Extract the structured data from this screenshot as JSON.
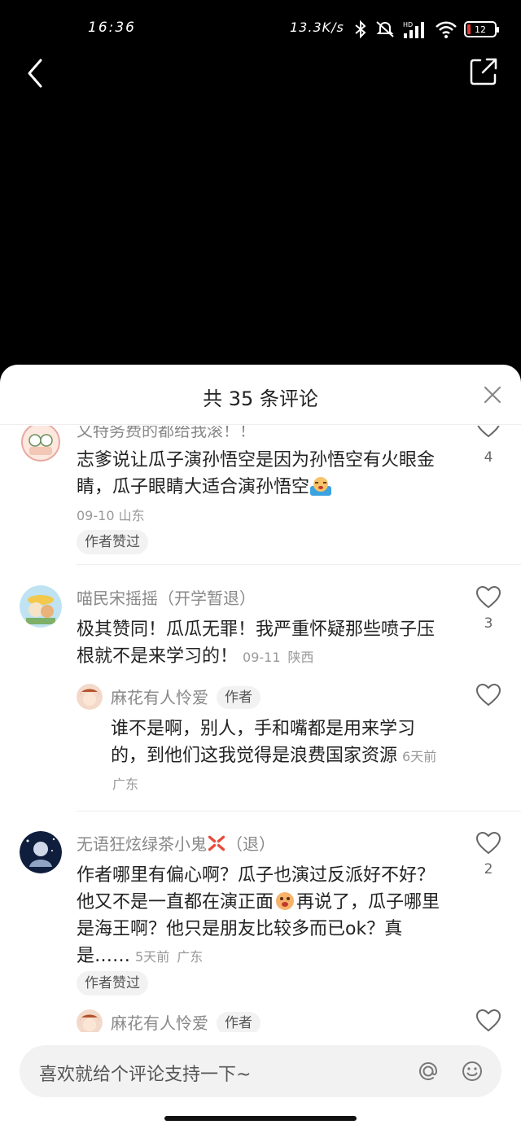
{
  "status_bar": {
    "time": "16:36",
    "net_speed": "13.3K/s",
    "signal_label": "HD",
    "battery_level": "12"
  },
  "sheet": {
    "title": "共 35 条评论",
    "close_icon": "close-icon"
  },
  "comments": [
    {
      "name": "又特务费的都给我滚！！",
      "text": "志爹说让瓜子演孙悟空是因为孙悟空有火眼金睛，瓜子眼睛大适合演孙悟空",
      "emoji": "crying-face",
      "time": "09-10",
      "location": "山东",
      "liked_by_author": "作者赞过",
      "likes": "4"
    },
    {
      "name": "喵民宋摇摇（开学暂退）",
      "text": "极其赞同！瓜瓜无罪！我严重怀疑那些喷子压根就不是来学习的！",
      "time": "09-11",
      "location": "陕西",
      "likes": "3",
      "reply": {
        "name": "麻花有人怜爱",
        "author_tag": "作者",
        "text": "谁不是啊，别人，手和嘴都是用来学习的，到他们这我觉得是浪费国家资源",
        "time": "6天前",
        "location": "广东"
      }
    },
    {
      "name": "无语狂炫绿茶小鬼",
      "name_suffix": "（退）",
      "text_a": "作者哪里有偏心啊？瓜子也演过反派好不好？他又不是一直都在演正面",
      "text_b": "再说了，瓜子哪里是海王啊？他只是朋友比较多而已ok？真是……",
      "time": "5天前",
      "location": "广东",
      "liked_by_author": "作者赞过",
      "likes": "2",
      "reply": {
        "name": "麻花有人怜爱",
        "author_tag": "作者"
      }
    }
  ],
  "input": {
    "placeholder": "喜欢就给个评论支持一下~"
  }
}
